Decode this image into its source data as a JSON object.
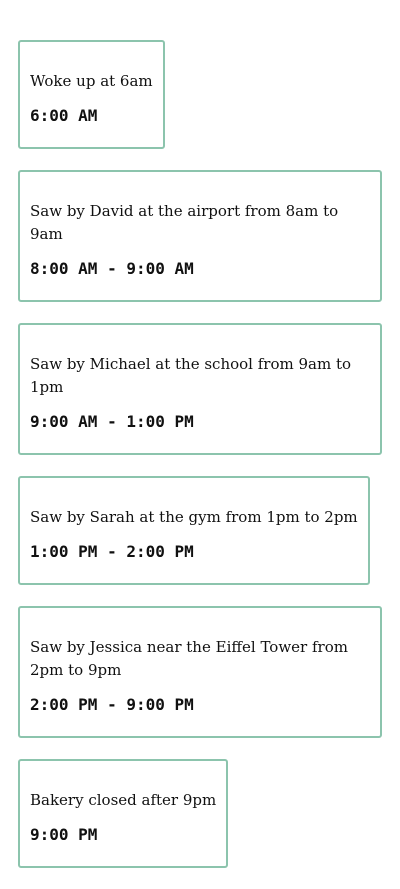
{
  "events": [
    {
      "description": "Woke up at 6am",
      "time": "6:00 AM"
    },
    {
      "description": "Saw by David at the airport from 8am to 9am",
      "time": "8:00 AM - 9:00 AM"
    },
    {
      "description": "Saw by Michael at the school from 9am to 1pm",
      "time": "9:00 AM - 1:00 PM"
    },
    {
      "description": "Saw by Sarah at the gym from 1pm to 2pm",
      "time": "1:00 PM - 2:00 PM"
    },
    {
      "description": "Saw by Jessica near the Eiffel Tower from 2pm to 9pm",
      "time": "2:00 PM - 9:00 PM"
    },
    {
      "description": "Bakery closed after 9pm",
      "time": "9:00 PM"
    }
  ],
  "colors": {
    "card_border": "#8cc4ad",
    "text": "#111111",
    "background": "#ffffff"
  }
}
